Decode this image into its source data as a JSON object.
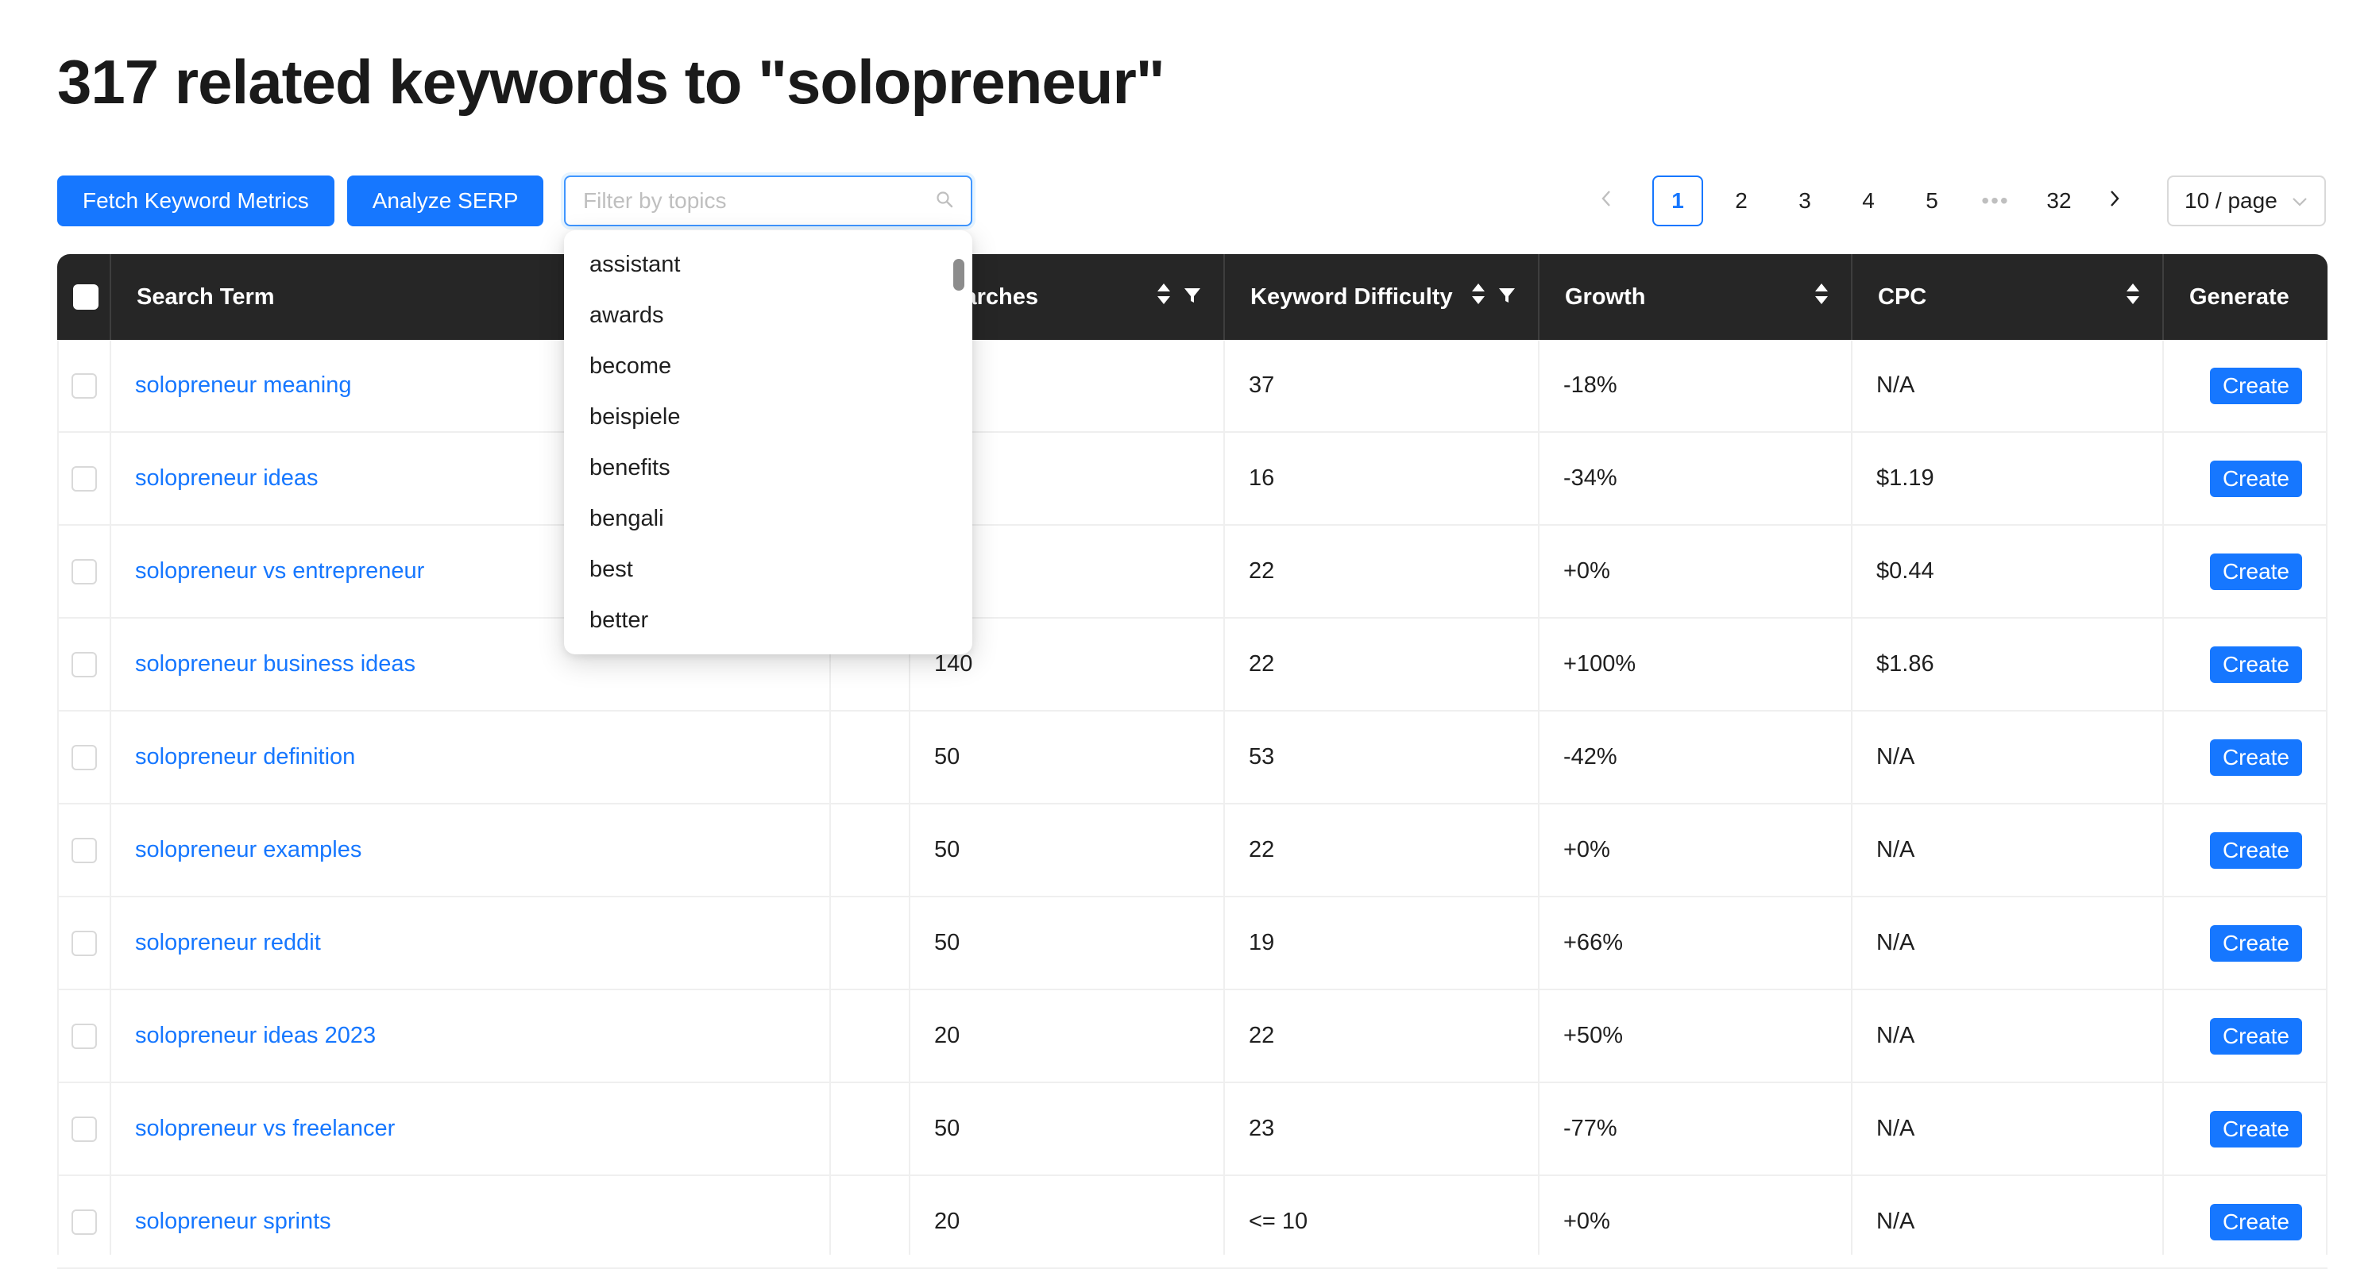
{
  "page_title": "317 related keywords to \"solopreneur\"",
  "toolbar": {
    "fetch_label": "Fetch Keyword Metrics",
    "analyze_label": "Analyze SERP",
    "filter_placeholder": "Filter by topics"
  },
  "pagination": {
    "pages": [
      "1",
      "2",
      "3",
      "4",
      "5"
    ],
    "ellipsis": "•••",
    "last": "32",
    "current": "1",
    "page_size": "10 / page"
  },
  "table": {
    "headers": {
      "search_term": "Search Term",
      "searches": "Searches",
      "difficulty": "Keyword Difficulty",
      "growth": "Growth",
      "cpc": "CPC",
      "generate": "Generate"
    },
    "create_label": "Create",
    "rows": [
      {
        "term": "solopreneur meaning",
        "searches": "",
        "difficulty": "37",
        "growth": "-18%",
        "cpc": "N/A"
      },
      {
        "term": "solopreneur ideas",
        "searches": "",
        "difficulty": "16",
        "growth": "-34%",
        "cpc": "$1.19"
      },
      {
        "term": "solopreneur vs entrepreneur",
        "searches": "",
        "difficulty": "22",
        "growth": "+0%",
        "cpc": "$0.44"
      },
      {
        "term": "solopreneur business ideas",
        "searches": "140",
        "difficulty": "22",
        "growth": "+100%",
        "cpc": "$1.86"
      },
      {
        "term": "solopreneur definition",
        "searches": "50",
        "difficulty": "53",
        "growth": "-42%",
        "cpc": "N/A"
      },
      {
        "term": "solopreneur examples",
        "searches": "50",
        "difficulty": "22",
        "growth": "+0%",
        "cpc": "N/A"
      },
      {
        "term": "solopreneur reddit",
        "searches": "50",
        "difficulty": "19",
        "growth": "+66%",
        "cpc": "N/A"
      },
      {
        "term": "solopreneur ideas 2023",
        "searches": "20",
        "difficulty": "22",
        "growth": "+50%",
        "cpc": "N/A"
      },
      {
        "term": "solopreneur vs freelancer",
        "searches": "50",
        "difficulty": "23",
        "growth": "-77%",
        "cpc": "N/A"
      },
      {
        "term": "solopreneur sprints",
        "searches": "20",
        "difficulty": "<= 10",
        "growth": "+0%",
        "cpc": "N/A"
      }
    ]
  },
  "dropdown": {
    "options": [
      "assistant",
      "awards",
      "become",
      "beispiele",
      "benefits",
      "bengali",
      "best",
      "better"
    ]
  },
  "colors": {
    "accent": "#1677ff",
    "header_bg": "#262626"
  }
}
